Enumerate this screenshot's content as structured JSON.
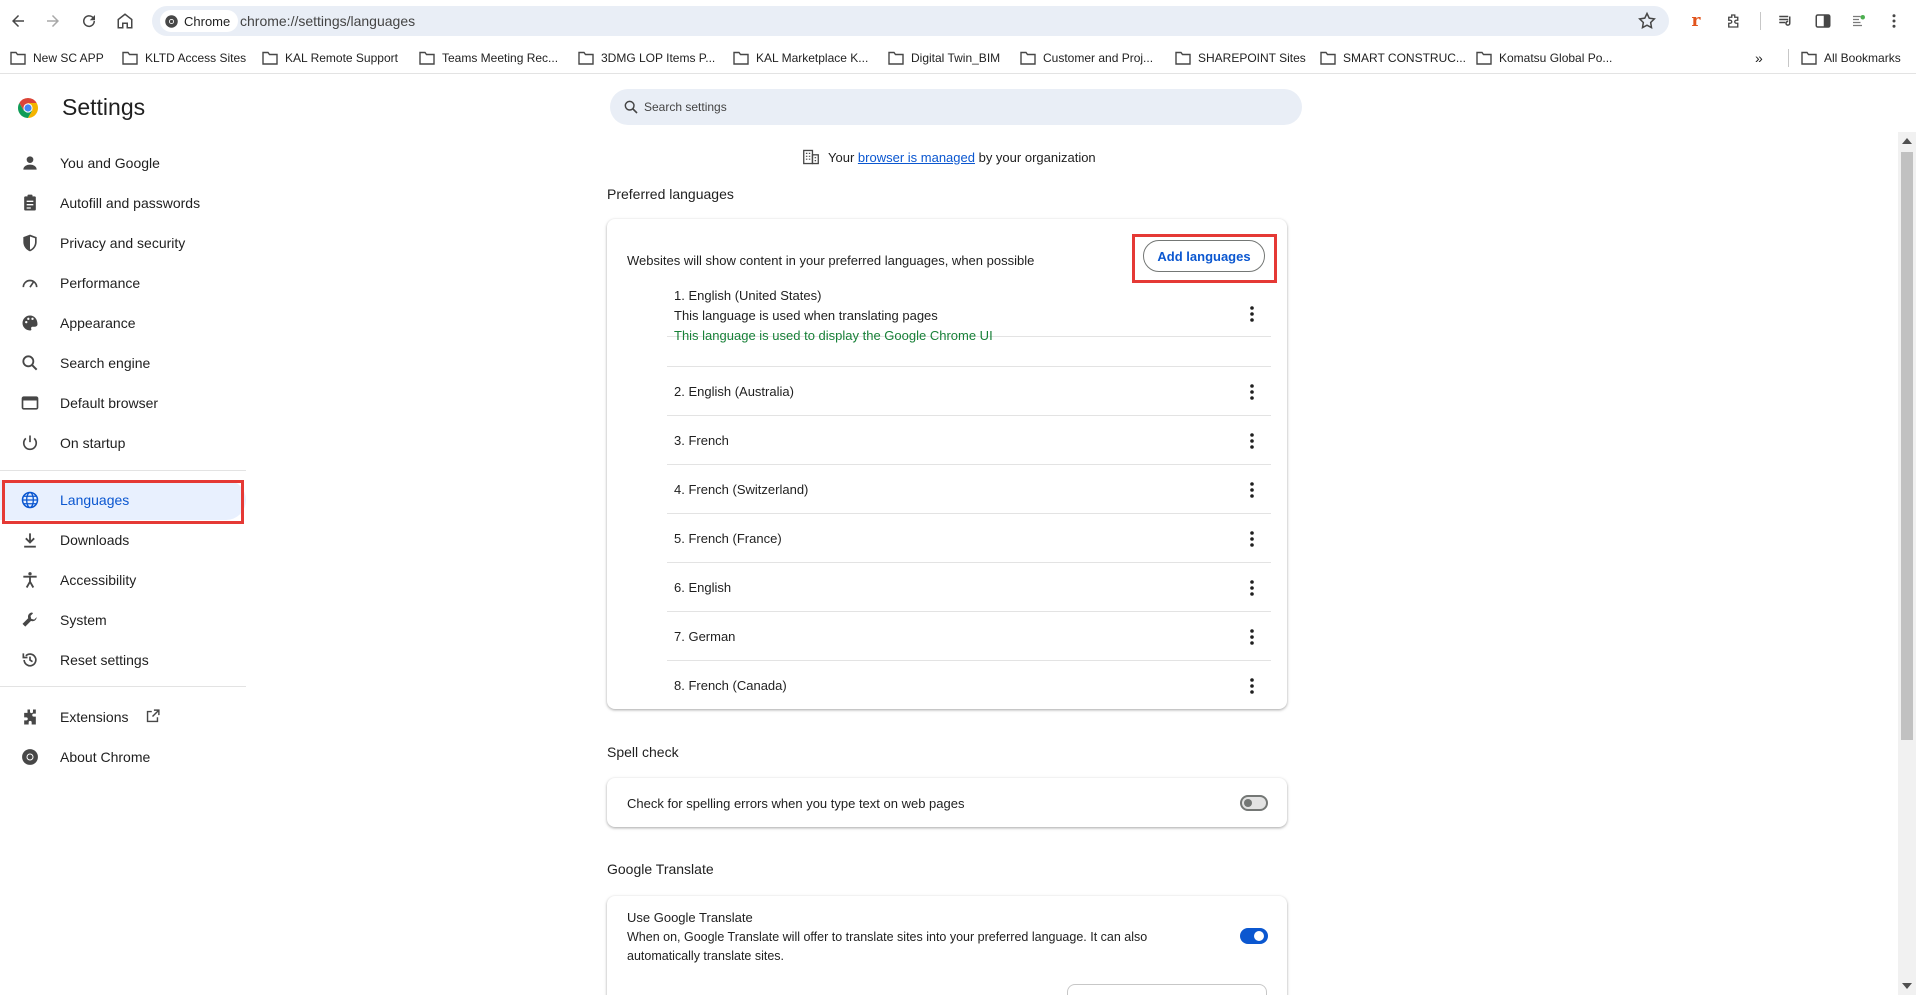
{
  "browser": {
    "chip_label": "Chrome",
    "url": "chrome://settings/languages"
  },
  "bookmarks": [
    {
      "label": "New SC APP"
    },
    {
      "label": "KLTD Access Sites"
    },
    {
      "label": "KAL Remote Support"
    },
    {
      "label": "Teams Meeting Rec..."
    },
    {
      "label": "3DMG LOP Items P..."
    },
    {
      "label": "KAL Marketplace K..."
    },
    {
      "label": "Digital Twin_BIM"
    },
    {
      "label": "Customer and Proj..."
    },
    {
      "label": "SHAREPOINT Sites"
    },
    {
      "label": "SMART CONSTRUC..."
    },
    {
      "label": "Komatsu Global Po..."
    }
  ],
  "all_bookmarks_label": "All Bookmarks",
  "settings": {
    "title": "Settings",
    "search_placeholder": "Search settings"
  },
  "sidebar": {
    "items": [
      {
        "label": "You and Google",
        "icon": "person-icon"
      },
      {
        "label": "Autofill and passwords",
        "icon": "clipboard-icon"
      },
      {
        "label": "Privacy and security",
        "icon": "shield-icon"
      },
      {
        "label": "Performance",
        "icon": "speedometer-icon"
      },
      {
        "label": "Appearance",
        "icon": "palette-icon"
      },
      {
        "label": "Search engine",
        "icon": "search-icon"
      },
      {
        "label": "Default browser",
        "icon": "browser-window-icon"
      },
      {
        "label": "On startup",
        "icon": "power-icon"
      },
      {
        "label": "Languages",
        "icon": "globe-icon",
        "active": true
      },
      {
        "label": "Downloads",
        "icon": "download-icon"
      },
      {
        "label": "Accessibility",
        "icon": "accessibility-icon"
      },
      {
        "label": "System",
        "icon": "wrench-icon"
      },
      {
        "label": "Reset settings",
        "icon": "history-icon"
      },
      {
        "label": "Extensions",
        "icon": "puzzle-icon"
      },
      {
        "label": "About Chrome",
        "icon": "chrome-icon"
      }
    ]
  },
  "managed_notice": {
    "prefix": "Your",
    "link": "browser is managed",
    "suffix": "by your organization"
  },
  "preferred_languages": {
    "section_title": "Preferred languages",
    "description": "Websites will show content in your preferred languages, when possible",
    "add_button": "Add languages",
    "languages": [
      {
        "name": "1. English (United States)",
        "note": "This language is used when translating pages",
        "ui_note": "This language is used to display the Google Chrome UI"
      },
      {
        "name": "2. English (Australia)"
      },
      {
        "name": "3. French"
      },
      {
        "name": "4. French (Switzerland)"
      },
      {
        "name": "5. French (France)"
      },
      {
        "name": "6. English"
      },
      {
        "name": "7. German"
      },
      {
        "name": "8. French (Canada)"
      }
    ]
  },
  "spell_check": {
    "section_title": "Spell check",
    "label": "Check for spelling errors when you type text on web pages",
    "enabled": false
  },
  "google_translate": {
    "section_title": "Google Translate",
    "label": "Use Google Translate",
    "description_line1": "When on, Google Translate will offer to translate sites into your preferred language. It can also",
    "description_line2": "automatically translate sites.",
    "enabled": true
  },
  "colors": {
    "accent": "#0b57d0",
    "highlight_box": "#e53935",
    "ui_language_note": "#188038"
  }
}
